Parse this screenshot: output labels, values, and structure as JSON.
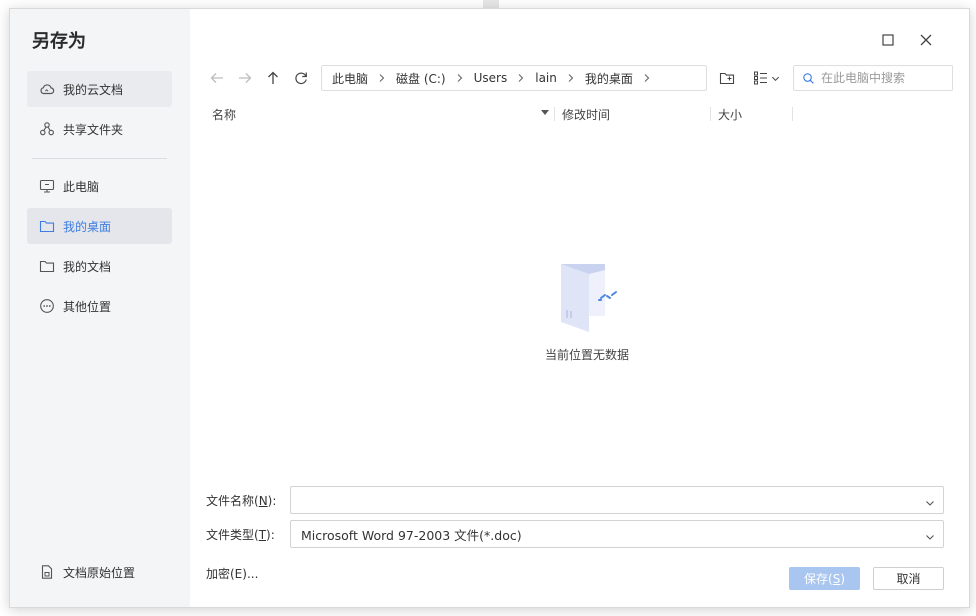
{
  "dialog": {
    "title": "另存为",
    "window_controls": {
      "maximize_icon": "square-icon",
      "close_icon": "close-icon"
    }
  },
  "sidebar": {
    "items": [
      {
        "label": "我的云文档",
        "icon": "cloud-icon",
        "active": false
      },
      {
        "label": "共享文件夹",
        "icon": "share-icon",
        "active": false
      },
      {
        "label": "此电脑",
        "icon": "monitor-icon",
        "active": false
      },
      {
        "label": "我的桌面",
        "icon": "folder-icon",
        "active": true
      },
      {
        "label": "我的文档",
        "icon": "folder-icon",
        "active": false
      },
      {
        "label": "其他位置",
        "icon": "more-circle-icon",
        "active": false
      }
    ],
    "bottom_label": "文档原始位置"
  },
  "toolbar": {
    "breadcrumb": [
      "此电脑",
      "磁盘 (C:)",
      "Users",
      "lain",
      "我的桌面"
    ],
    "search_placeholder": "在此电脑中搜索"
  },
  "columns": {
    "name": "名称",
    "modified": "修改时间",
    "size": "大小"
  },
  "empty_state": {
    "message": "当前位置无数据"
  },
  "form": {
    "filename_label": "文件名称(",
    "filename_key": "N",
    "filename_label_end": "):",
    "filename_value": "",
    "filetype_label": "文件类型(",
    "filetype_key": "T",
    "filetype_label_end": "):",
    "filetype_value": "Microsoft Word 97-2003 文件(*.doc)",
    "encrypt_label": "加密(E)..."
  },
  "buttons": {
    "save_label": "保存(",
    "save_key": "S",
    "save_end": ")",
    "cancel_label": "取消"
  },
  "colors": {
    "accent": "#3d7ce0",
    "save_disabled": "#a9c6f1",
    "sidebar_bg": "#f4f5f7"
  }
}
